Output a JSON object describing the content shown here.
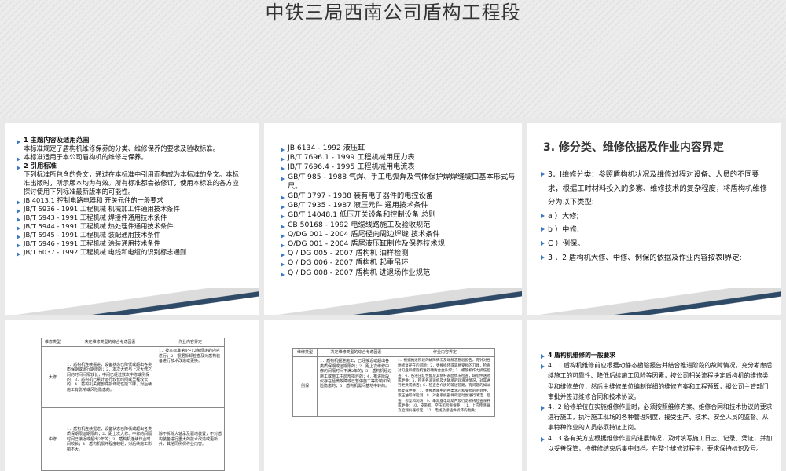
{
  "title": "中铁三局西南公司盾构工程段",
  "slide1": {
    "lines": [
      {
        "text": "1  主题内容及适用范围",
        "bold": true,
        "bullet": true
      },
      {
        "text": "    本标准规定了盾构机维修保养的分类、维修保养的要求及验收标准。",
        "bullet": false
      },
      {
        "text": "  本标准适用于本公司盾构机的维修与保养。",
        "bullet": true
      },
      {
        "text": "2  引用标准",
        "bold": true,
        "bullet": true
      },
      {
        "text": "    下列标准所包含的条文，通过在本标准中引用而构成为本标准的条文。本标准出版时，所示版本均为有效。所有标准都会被修订，使用本标准的各方应探讨使用下列标准最新版本的可能性。",
        "bullet": false
      },
      {
        "text": "JB  4013.1            控制电路电器和  开关元件的一般要求",
        "bullet": true
      },
      {
        "text": "JB/T 5936   -  1991   工程机械  机械加工件通用技术条件",
        "bullet": true
      },
      {
        "text": "JB/T 5943   -  1991   工程机械  焊接件通用技术条件",
        "bullet": true
      },
      {
        "text": "JB/T 5944   -  1991   工程机械  热处理件通用技术条件",
        "bullet": true
      },
      {
        "text": "JB/T 5945   -  1991   工程机械  装配通用技术条件",
        "bullet": true
      },
      {
        "text": "JB/T 5946   -  1991   工程机械  涂装通用技术条件",
        "bullet": true
      },
      {
        "text": "JB/T 6037   -  1992   工程机械  电线和电缆的识别标志通则",
        "bullet": true
      }
    ]
  },
  "slide2": {
    "lines": [
      " JB  6134    - 1992   液压缸",
      "JB/T 7696.1   - 1999   工程机械用压力表",
      "JB/T 7696.4   - 1995   工程机械用电流表",
      "GB/T 985   - 1988   气焊、手工电弧焊及气体保护焊焊缝坡口基本形式与尺。",
      "GB/T 3797    - 1988   装有电子器件的电控设备",
      "GB/T 7935    - 1987   液压元件  通用技术条件",
      "GB/T 14048.1        低压开关设备和控制设备  总则",
      "CB 50168 - 1992      电缆线路施工及验收规范",
      "Q/DG 001    - 2004   盾尾径向周边焊缝  技术条件",
      "Q/DG 001    - 2004   盾尾液压缸制作及保养技术规",
      "Q  /  DG 005    -  2007    盾构机  油样检测",
      "Q  /  DG 006    -  2007    盾构机  起重吊环",
      "Q  /  DG 008    -  2007    盾构机  进退场作业规范"
    ]
  },
  "slide3": {
    "heading": "3. 修分类、维修依据及作业内容界定",
    "lines": [
      {
        "text": "3．Ⅰ维修分类：参照盾构机状况及维修过程对设备、人员的不同要求，根据工时材料投入的多寡、维修技术的复杂程度，将盾构机维修分为以下类型:",
        "bullet": true
      },
      {
        "text": "        a ）大修;",
        "bullet": true
      },
      {
        "text": "        b ）中修;",
        "bullet": true
      },
      {
        "text": "        C ）例保。",
        "bullet": true
      },
      {
        "text": "    3 ．2 盾构机大修、中修、例保的依据及作业内容按表Ⅰ界定:",
        "bullet": true
      }
    ]
  },
  "slide4": {
    "headers": [
      "维修类型",
      "决定维修类型的综合考虑因素",
      "作业内容界定"
    ],
    "rows": [
      {
        "type": "大修",
        "factors": "1．盾构机连续掘进，设备状态已降低或超出各类质保期或运行期限的；2．本次大修与上次大修之间的时间间隔较长，中间已经过数次中修或例保的；3．盾构机已累计运行较长时间或里程较长的；4．盾构机关键部件损坏或性能下降，对后续施工有影响或风险隐患的。",
        "content": "1．按本标准第4～12条规定的内容进行；2．根据拆卸检查及对盾构装备进行技术改造或更换。"
      },
      {
        "type": "中修",
        "factors": "1．盾构机连续掘进，设备状态已降低或超出各类质保期限运期限的；2．距上次大修、中修的间隔时间已接近或超出2年的；3．盾构机连续作业时间较长；4．盾构机损坏程度较轻，对后续施工影响不大。",
        "content": "除不拆除大轴承及驱动装置，不对盾构装备进行重大的技术改造或更新外，其他同例保作业内容。"
      }
    ]
  },
  "slide5": {
    "headers": [
      "维修类型",
      "决定维修类型的综合考虑因素",
      "作业内容界定"
    ],
    "rows": [
      {
        "type": "例保",
        "factors": "1．盾构机掘进施工，已经接近或超出各类质保期或运期限的；2．距上次维修中修的间隔时间不满2年的；3．盾构机经过施工或施工中局部损坏的；4．推进阶段仪存在轻微故障或已暂停施工等影响和风险隐患的；5．盾构机需间基地中转的。",
        "content": "1．根据推进阶段的故障情况及动静态勘验报告，有针对性地修复存在的问题；2．更换损坏或容易受损的刀具，检查对刀盘和螺旋机进行硬质合金补焊；3．螺旋机作力损伤检查；4．各液压缸性能及其侧杆表面情况检查，缺陷件送修或更换；5．检查各减速机及大轴承的润滑油情况，对其进行更换或清洁；6．检查各介质的输送管路，有问题的如以修复或更换；7．更换盾尾中的各类油芯和受损的密封件，液压油取样检测；8．对各系统部件的运动副进行清洁、检查、修复和润滑；9．串双座电动葫芦及行走机构检查保养或更换；10．皮带机、空压机检查保养；11．上应传感器及检测仪器标定；12．电线及接插件损坏的更换；"
      }
    ]
  },
  "slide6": {
    "lines": [
      {
        "text": "4   盾构机维修的一般要求",
        "bold": true
      },
      {
        "text": "4．1 盾构机维修前应根据动静态勘验报告并结合推进阶段的故障情况，充分考虑后续施工的可靠性、降低后续施工风险等因素，按公司相关流程决定盾构机的维修类型和维修单位，然后由维修单位编制详细的维修方案和工程预算，报公司主管部门审批并签订维修合同和技术协议。",
        "bold": false
      },
      {
        "text": "4．2 给修单位在实施维修作业时，必须按照维修方案、维修合同和技术协议的要求进行施工，执行施工现场的各种管理制度，接受生产、技术、安全人员的监督。从事特种作业的人员必须持证上岗。",
        "bold": false
      },
      {
        "text": "4．3 各有关方应根据维修作业的进展情况，及时填写施工日志、记录、凭证，并加 以妥善保管，持维修结束后集中归档。在整个维修过程中，要求保持标识及号。",
        "bold": false
      }
    ]
  }
}
